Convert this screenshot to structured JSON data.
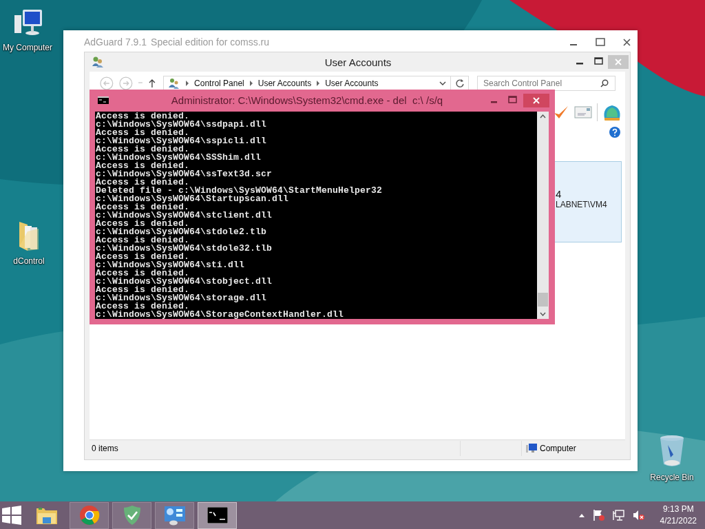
{
  "desktop_icons": [
    {
      "label": "My Computer",
      "kind": "computer"
    },
    {
      "label": "dControl",
      "kind": "folder"
    },
    {
      "label": "Recycle Bin",
      "kind": "recycle"
    }
  ],
  "adguard_window": {
    "title": "AdGuard 7.9.1",
    "subtitle": "Special edition for comss.ru"
  },
  "explorer_window": {
    "title": "User Accounts",
    "breadcrumb": [
      "Control Panel",
      "User Accounts",
      "User Accounts"
    ],
    "search": {
      "placeholder": "Search Control Panel"
    },
    "account_panel": {
      "line_1": "4",
      "line_2": "LABNET\\VM4"
    },
    "status_bar": {
      "items": "0 items",
      "location": "Computer"
    }
  },
  "cmd_window": {
    "title": "Administrator: C:\\Windows\\System32\\cmd.exe - del  c:\\ /s/q",
    "lines": [
      "Access is denied.",
      "c:\\Windows\\SysWOW64\\ssdpapi.dll",
      "Access is denied.",
      "c:\\Windows\\SysWOW64\\sspicli.dll",
      "Access is denied.",
      "c:\\Windows\\SysWOW64\\SSShim.dll",
      "Access is denied.",
      "c:\\Windows\\SysWOW64\\ssText3d.scr",
      "Access is denied.",
      "Deleted file - c:\\Windows\\SysWOW64\\StartMenuHelper32",
      "c:\\Windows\\SysWOW64\\Startupscan.dll",
      "Access is denied.",
      "c:\\Windows\\SysWOW64\\stclient.dll",
      "Access is denied.",
      "c:\\Windows\\SysWOW64\\stdole2.tlb",
      "Access is denied.",
      "c:\\Windows\\SysWOW64\\stdole32.tlb",
      "Access is denied.",
      "c:\\Windows\\SysWOW64\\sti.dll",
      "Access is denied.",
      "c:\\Windows\\SysWOW64\\stobject.dll",
      "Access is denied.",
      "c:\\Windows\\SysWOW64\\storage.dll",
      "Access is denied.",
      "c:\\Windows\\SysWOW64\\StorageContextHandler.dll"
    ]
  },
  "taskbar": {
    "apps": [
      {
        "kind": "explorer",
        "running": false,
        "selected": false
      },
      {
        "kind": "chrome",
        "running": true,
        "selected": false
      },
      {
        "kind": "adguard",
        "running": true,
        "selected": false
      },
      {
        "kind": "control-panel",
        "running": true,
        "selected": false
      },
      {
        "kind": "cmd",
        "running": true,
        "selected": true
      }
    ],
    "clock": {
      "time": "9:13 PM",
      "date": "4/21/2022"
    }
  }
}
